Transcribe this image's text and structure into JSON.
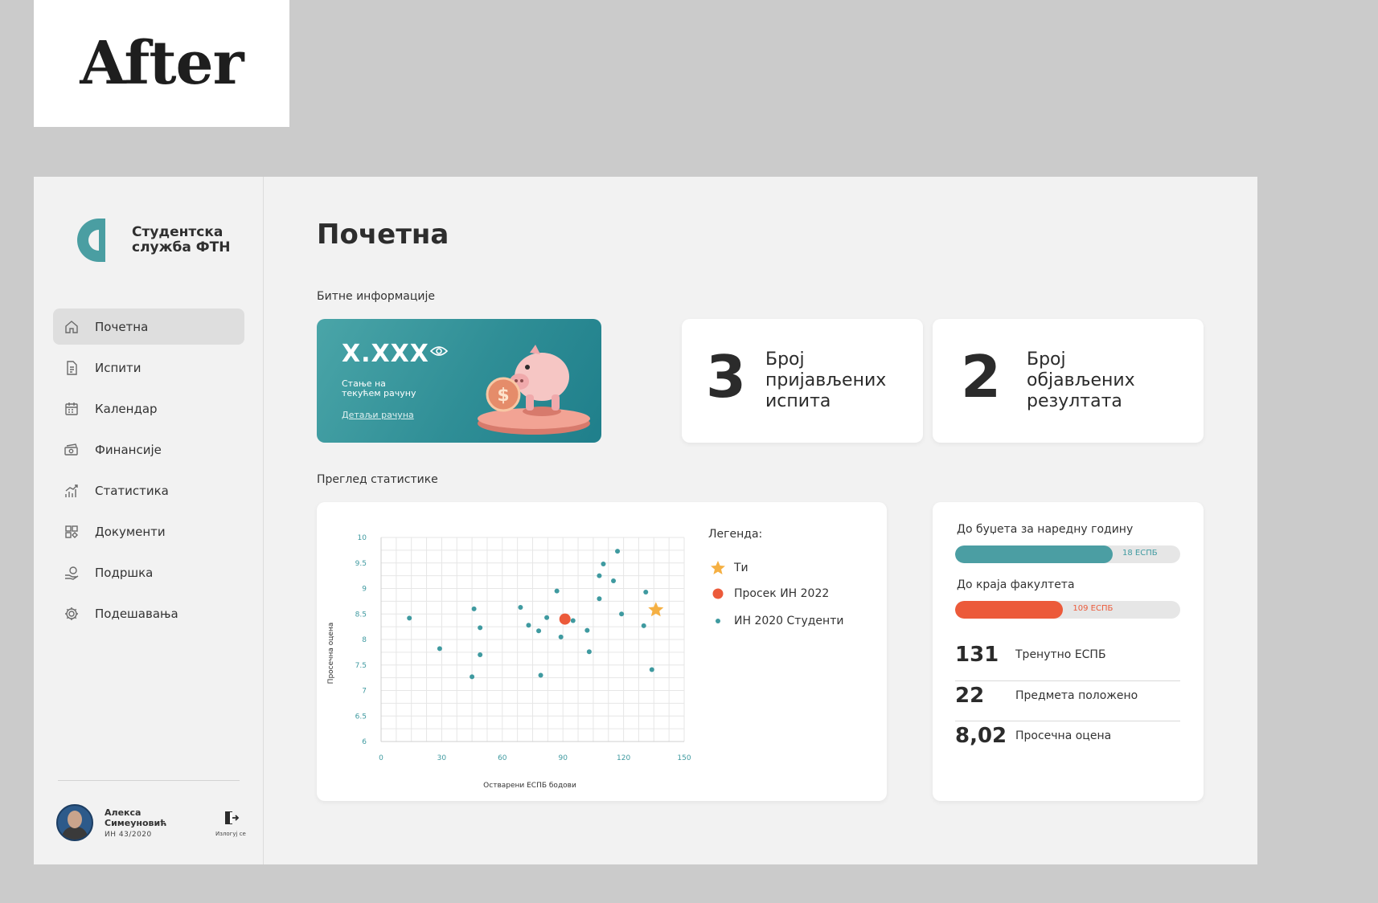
{
  "badge": {
    "label": "After"
  },
  "brand": {
    "line1": "Студентска",
    "line2": "служба ФТН"
  },
  "nav": [
    {
      "label": "Почетна",
      "icon": "home-icon",
      "active": true
    },
    {
      "label": "Испити",
      "icon": "document-icon",
      "active": false
    },
    {
      "label": "Календар",
      "icon": "calendar-icon",
      "active": false
    },
    {
      "label": "Финансије",
      "icon": "money-icon",
      "active": false
    },
    {
      "label": "Статистика",
      "icon": "chart-icon",
      "active": false
    },
    {
      "label": "Документи",
      "icon": "grid-icon",
      "active": false
    },
    {
      "label": "Подршка",
      "icon": "support-icon",
      "active": false
    },
    {
      "label": "Подешавања",
      "icon": "gear-icon",
      "active": false
    }
  ],
  "user": {
    "first": "Алекса",
    "last": "Симеуновић",
    "index": "ИН 43/2020",
    "logout": "Излогуј се"
  },
  "page": {
    "title": "Почетна"
  },
  "info": {
    "label": "Битне информације",
    "balance": {
      "amount": "X.XXX",
      "line1": "Стање на",
      "line2": "текућем рачуну",
      "link": "Детаљи рачуна"
    },
    "exams": {
      "count": "3",
      "l1": "Број",
      "l2": "пријављених",
      "l3": "испита"
    },
    "results": {
      "count": "2",
      "l1": "Број",
      "l2": "објављених",
      "l3": "резултата"
    }
  },
  "stats": {
    "label": "Преглед статистике"
  },
  "legend": {
    "title": "Легенда:",
    "items": [
      {
        "label": "Ти",
        "symbol": "star",
        "color": "#f5b043"
      },
      {
        "label": "Просек ИН 2022",
        "symbol": "dot-large",
        "color": "#ec5a3a"
      },
      {
        "label": "ИН 2020 Студенти",
        "symbol": "dot-small",
        "color": "#3f9aa0"
      }
    ]
  },
  "chart_data": {
    "type": "scatter",
    "xlabel": "Остварени ЕСПБ бодови",
    "ylabel": "Просечна оцена",
    "xlim": [
      0,
      150
    ],
    "ylim": [
      6,
      10
    ],
    "xticks": [
      "0",
      "30",
      "60",
      "90",
      "120",
      "150"
    ],
    "yticks": [
      "6",
      "6.5",
      "7",
      "7.5",
      "8",
      "8.5",
      "9",
      "9.5",
      "10"
    ],
    "grid": true,
    "colors": {
      "students": "#3f9aa0",
      "average": "#ec5a3a",
      "you": "#f5b043"
    },
    "series": [
      {
        "name": "ИН 2020 Студенти",
        "points": [
          [
            14,
            8.42
          ],
          [
            29,
            7.82
          ],
          [
            45,
            7.27
          ],
          [
            46,
            8.6
          ],
          [
            49,
            8.23
          ],
          [
            49,
            7.7
          ],
          [
            69,
            8.63
          ],
          [
            73,
            8.28
          ],
          [
            78,
            8.17
          ],
          [
            79,
            7.3
          ],
          [
            82,
            8.43
          ],
          [
            87,
            8.95
          ],
          [
            89,
            8.05
          ],
          [
            95,
            8.37
          ],
          [
            102,
            8.18
          ],
          [
            103,
            7.76
          ],
          [
            108,
            9.25
          ],
          [
            108,
            8.8
          ],
          [
            110,
            9.48
          ],
          [
            115,
            9.15
          ],
          [
            117,
            9.73
          ],
          [
            119,
            8.5
          ],
          [
            130,
            8.27
          ],
          [
            131,
            8.93
          ],
          [
            134,
            7.41
          ]
        ]
      },
      {
        "name": "Просек ИН 2022",
        "points": [
          [
            91,
            8.4
          ]
        ]
      },
      {
        "name": "Ти",
        "points": [
          [
            136,
            8.58
          ]
        ]
      }
    ]
  },
  "progress": [
    {
      "label": "До буџета за наредну годину",
      "value": "18 ЕСПБ",
      "fraction": 0.7,
      "color": "#4b9ea3"
    },
    {
      "label": "До краја факултета",
      "value": "109 ЕСПБ",
      "fraction": 0.48,
      "color": "#ec5a3a"
    }
  ],
  "kpis": [
    {
      "number": "131",
      "label": "Тренутно ЕСПБ"
    },
    {
      "number": "22",
      "label": "Предмета положено"
    },
    {
      "number": "8,02",
      "label": "Просечна оцена"
    }
  ]
}
